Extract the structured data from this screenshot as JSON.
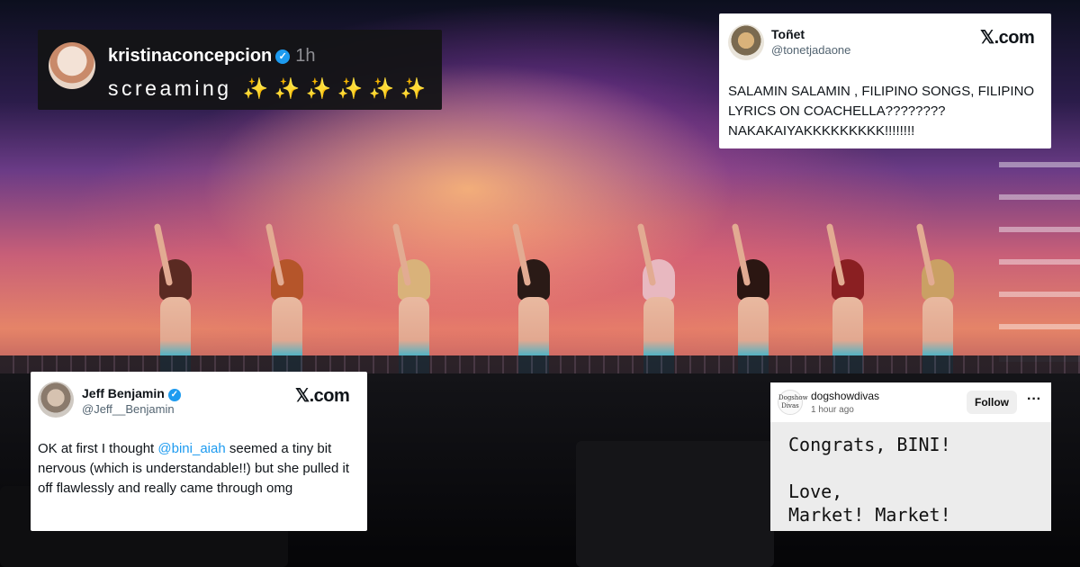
{
  "tweet_dark": {
    "username": "kristinaconcepcion",
    "time": "1h",
    "text": "screaming",
    "sparkles": "✨ ✨ ✨ ✨ ✨ ✨"
  },
  "tweet_tonet": {
    "name": "Toñet",
    "handle": "@tonetjadaone",
    "brand": "𝕏.com",
    "body": "SALAMIN SALAMIN , FILIPINO SONGS, FILIPINO LYRICS ON COACHELLA???????? NAKAKAIYAKKKKKKKKK!!!!!!!!"
  },
  "tweet_jeff": {
    "name": "Jeff Benjamin",
    "handle": "@Jeff__Benjamin",
    "brand": "𝕏.com",
    "body_before": "OK at first I thought ",
    "mention": "@bini_aiah",
    "body_after": " seemed a tiny bit nervous (which is understandable!!) but she pulled it off flawlessly and really came through omg"
  },
  "instagram": {
    "avatar_text": "Dogshow Divas",
    "username": "dogshowdivas",
    "time": "1 hour ago",
    "follow_label": "Follow",
    "more_label": "···",
    "message": "Congrats, BINI!\n\nLove,\nMarket! Market!"
  },
  "icons": {
    "verified": "verified-check-icon",
    "more": "more-options-icon"
  },
  "colors": {
    "x_blue": "#1d9bf0",
    "dark_card_bg": "#141416",
    "ig_post_bg": "#ececec"
  }
}
